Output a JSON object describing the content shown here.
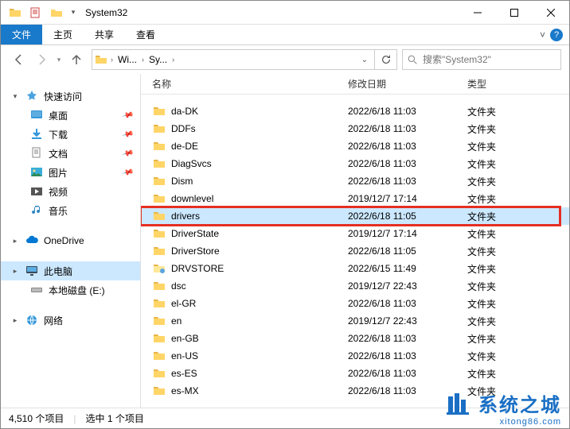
{
  "window": {
    "title": "System32"
  },
  "ribbon": {
    "tabs": [
      "文件",
      "主页",
      "共享",
      "查看"
    ]
  },
  "address": {
    "segments": [
      "Wi...",
      "Sy...",
      ""
    ],
    "search_placeholder": "搜索\"System32\""
  },
  "sidebar": {
    "quick_access": {
      "label": "快速访问",
      "items": [
        {
          "label": "桌面",
          "icon": "desktop",
          "pinned": true
        },
        {
          "label": "下载",
          "icon": "downloads",
          "pinned": true
        },
        {
          "label": "文档",
          "icon": "documents",
          "pinned": true
        },
        {
          "label": "图片",
          "icon": "pictures",
          "pinned": true
        },
        {
          "label": "视频",
          "icon": "videos",
          "pinned": false
        },
        {
          "label": "音乐",
          "icon": "music",
          "pinned": false
        }
      ]
    },
    "onedrive": {
      "label": "OneDrive"
    },
    "this_pc": {
      "label": "此电脑"
    },
    "local_disk": {
      "label": "本地磁盘 (E:)"
    },
    "network": {
      "label": "网络"
    }
  },
  "columns": {
    "name": "名称",
    "date": "修改日期",
    "type": "类型"
  },
  "files": [
    {
      "name": "da-DK",
      "date": "2022/6/18 11:03",
      "type": "文件夹"
    },
    {
      "name": "DDFs",
      "date": "2022/6/18 11:03",
      "type": "文件夹"
    },
    {
      "name": "de-DE",
      "date": "2022/6/18 11:03",
      "type": "文件夹"
    },
    {
      "name": "DiagSvcs",
      "date": "2022/6/18 11:03",
      "type": "文件夹"
    },
    {
      "name": "Dism",
      "date": "2022/6/18 11:03",
      "type": "文件夹"
    },
    {
      "name": "downlevel",
      "date": "2019/12/7 17:14",
      "type": "文件夹"
    },
    {
      "name": "drivers",
      "date": "2022/6/18 11:05",
      "type": "文件夹",
      "selected": true,
      "highlight": true
    },
    {
      "name": "DriverState",
      "date": "2019/12/7 17:14",
      "type": "文件夹"
    },
    {
      "name": "DriverStore",
      "date": "2022/6/18 11:05",
      "type": "文件夹"
    },
    {
      "name": "DRVSTORE",
      "date": "2022/6/15 11:49",
      "type": "文件夹",
      "special": "drvstore"
    },
    {
      "name": "dsc",
      "date": "2019/12/7 22:43",
      "type": "文件夹"
    },
    {
      "name": "el-GR",
      "date": "2022/6/18 11:03",
      "type": "文件夹"
    },
    {
      "name": "en",
      "date": "2019/12/7 22:43",
      "type": "文件夹"
    },
    {
      "name": "en-GB",
      "date": "2022/6/18 11:03",
      "type": "文件夹"
    },
    {
      "name": "en-US",
      "date": "2022/6/18 11:03",
      "type": "文件夹"
    },
    {
      "name": "es-ES",
      "date": "2022/6/18 11:03",
      "type": "文件夹"
    },
    {
      "name": "es-MX",
      "date": "2022/6/18 11:03",
      "type": "文件夹"
    }
  ],
  "status": {
    "total": "4,510 个项目",
    "selected": "选中 1 个项目"
  },
  "watermark": {
    "text": "系统之城",
    "sub": "xitong86.com"
  }
}
